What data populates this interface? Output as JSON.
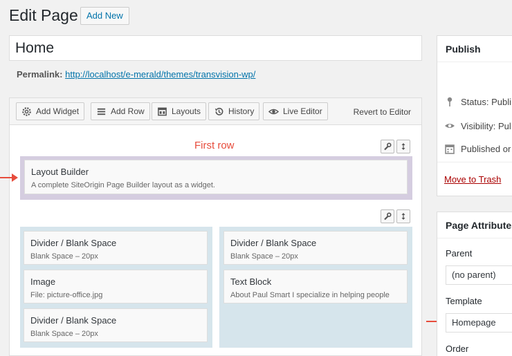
{
  "header": {
    "title": "Edit Page",
    "add_new": "Add New"
  },
  "post_title": "Home",
  "permalink": {
    "label": "Permalink:",
    "url": "http://localhost/e-merald/themes/transvision-wp/"
  },
  "toolbar": {
    "buttons": [
      {
        "label": "Add Widget",
        "icon": "gear-icon"
      },
      {
        "label": "Add Row",
        "icon": "rows-icon"
      },
      {
        "label": "Layouts",
        "icon": "layout-icon"
      },
      {
        "label": "History",
        "icon": "history-icon"
      },
      {
        "label": "Live Editor",
        "icon": "eye-icon"
      }
    ],
    "revert": "Revert to Editor"
  },
  "rows": {
    "first_row_label": "First row",
    "row1_widget": {
      "title": "Layout Builder",
      "desc": "A complete SiteOrigin Page Builder layout as a widget."
    },
    "row2_left": [
      {
        "title": "Divider / Blank Space",
        "desc": "Blank Space  –  20px"
      },
      {
        "title": "Image",
        "desc": "File: picture-office.jpg"
      },
      {
        "title": "Divider / Blank Space",
        "desc": "Blank Space  –  20px"
      }
    ],
    "row2_right": [
      {
        "title": "Divider / Blank Space",
        "desc": "Blank Space  –  20px"
      },
      {
        "title": "Text Block",
        "desc": "About Paul Smart I specialize in helping people"
      }
    ]
  },
  "publish": {
    "title": "Publish",
    "status": "Status: Publi",
    "visibility": "Visibility: Pul",
    "published": "Published or",
    "trash": "Move to Trash"
  },
  "page_attributes": {
    "title": "Page Attributes",
    "parent_label": "Parent",
    "parent_value": "(no parent)",
    "template_label": "Template",
    "template_value": "Homepage",
    "order_label": "Order"
  },
  "colors": {
    "accent": "#0073aa",
    "annotation": "#e74c3c",
    "row1_bg": "#d5cde0",
    "row2_bg": "#d6e5ec"
  }
}
